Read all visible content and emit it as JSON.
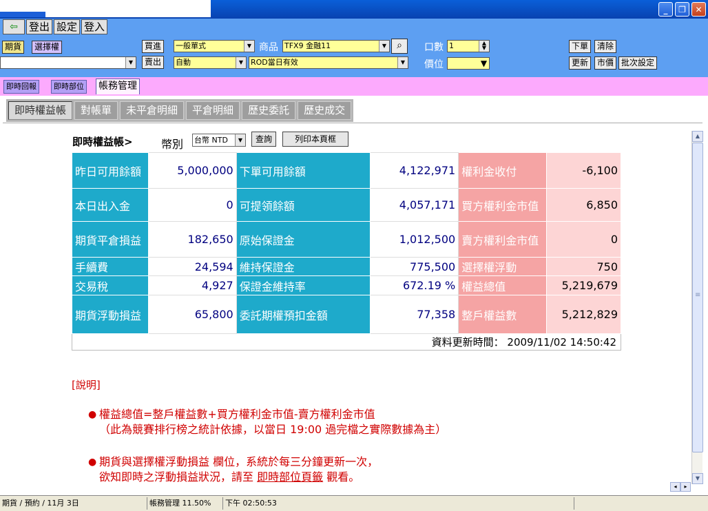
{
  "window": {
    "controls": {
      "minimize": "_",
      "restore": "❐",
      "close": "✕"
    }
  },
  "toolbar": {
    "logout": "登出",
    "settings": "設定",
    "login": "登入"
  },
  "order_panel": {
    "futures_btn": "期貨",
    "options_btn": "選擇權",
    "buy_btn": "買進",
    "sell_btn": "賣出",
    "order_type": "一般單式",
    "order_mode": "自動",
    "product_label": "商品",
    "product_value": "TFX9 金融11",
    "duration_value": "ROD當日有效",
    "qty_label": "口數",
    "qty_value": "1",
    "price_label": "價位",
    "place_order_btn": "下單",
    "clear_btn": "清除",
    "update_btn": "更新",
    "market_btn": "市價",
    "batch_btn": "批次設定"
  },
  "panel_tabs": [
    {
      "label": "即時回報"
    },
    {
      "label": "即時部位"
    },
    {
      "label": "帳務管理"
    }
  ],
  "sub_tabs": [
    {
      "label": "即時權益帳"
    },
    {
      "label": "對帳單"
    },
    {
      "label": "未平倉明細"
    },
    {
      "label": "平倉明細"
    },
    {
      "label": "歷史委託"
    },
    {
      "label": "歷史成交"
    }
  ],
  "equity": {
    "title": "即時權益帳>",
    "currency_label": "幣別",
    "currency_value": "台幣 NTD",
    "query_btn": "查詢",
    "print_btn": "列印本頁框",
    "rows": [
      {
        "l1": "昨日可用餘額",
        "v1": "5,000,000",
        "l2": "下單可用餘額",
        "v2": "4,122,971",
        "l3": "權利金收付",
        "v3": "-6,100"
      },
      {
        "l1": "本日出入金",
        "v1": "0",
        "l2": "可提領餘額",
        "v2": "4,057,171",
        "l3": "買方權利金市值",
        "v3": "6,850"
      },
      {
        "l1": "期貨平倉損益",
        "v1": "182,650",
        "l2": "原始保證金",
        "v2": "1,012,500",
        "l3": "賣方權利金市值",
        "v3": "0"
      },
      {
        "l1": "手續費",
        "v1": "24,594",
        "l2": "維持保證金",
        "v2": "775,500",
        "l3": "選擇權浮動",
        "v3": "750"
      },
      {
        "l1": "交易稅",
        "v1": "4,927",
        "l2": "保證金維持率",
        "v2": "672.19 %",
        "l3": "權益總值",
        "v3": "5,219,679"
      },
      {
        "l1": "期貨浮動損益",
        "v1": "65,800",
        "l2": "委託期權預扣金額",
        "v2": "77,358",
        "l3": "整戶權益數",
        "v3": "5,212,829"
      }
    ],
    "update_label": "資料更新時間：",
    "update_time": "2009/11/02 14:50:42"
  },
  "notes": {
    "title": "[說明]",
    "note1_line1": "權益總值=整戶權益數+買方權利金市值-賣方權利金市值",
    "note1_line2": "（此為競賽排行榜之統計依據，以當日 19:00 過完檔之實際數據為主）",
    "note2_line1": "期貨與選擇權浮動損益 欄位，系統於每三分鐘更新一次，",
    "note2_line2_pre": "欲知即時之浮動損益狀況，請至",
    "note2_link": "即時部位頁籤",
    "note2_line2_post": "觀看。"
  },
  "status": {
    "s1": "期貨 / 預約 / 11月 3日",
    "s2": "帳務管理  11.50%",
    "s3": "下午 02:50:53"
  }
}
